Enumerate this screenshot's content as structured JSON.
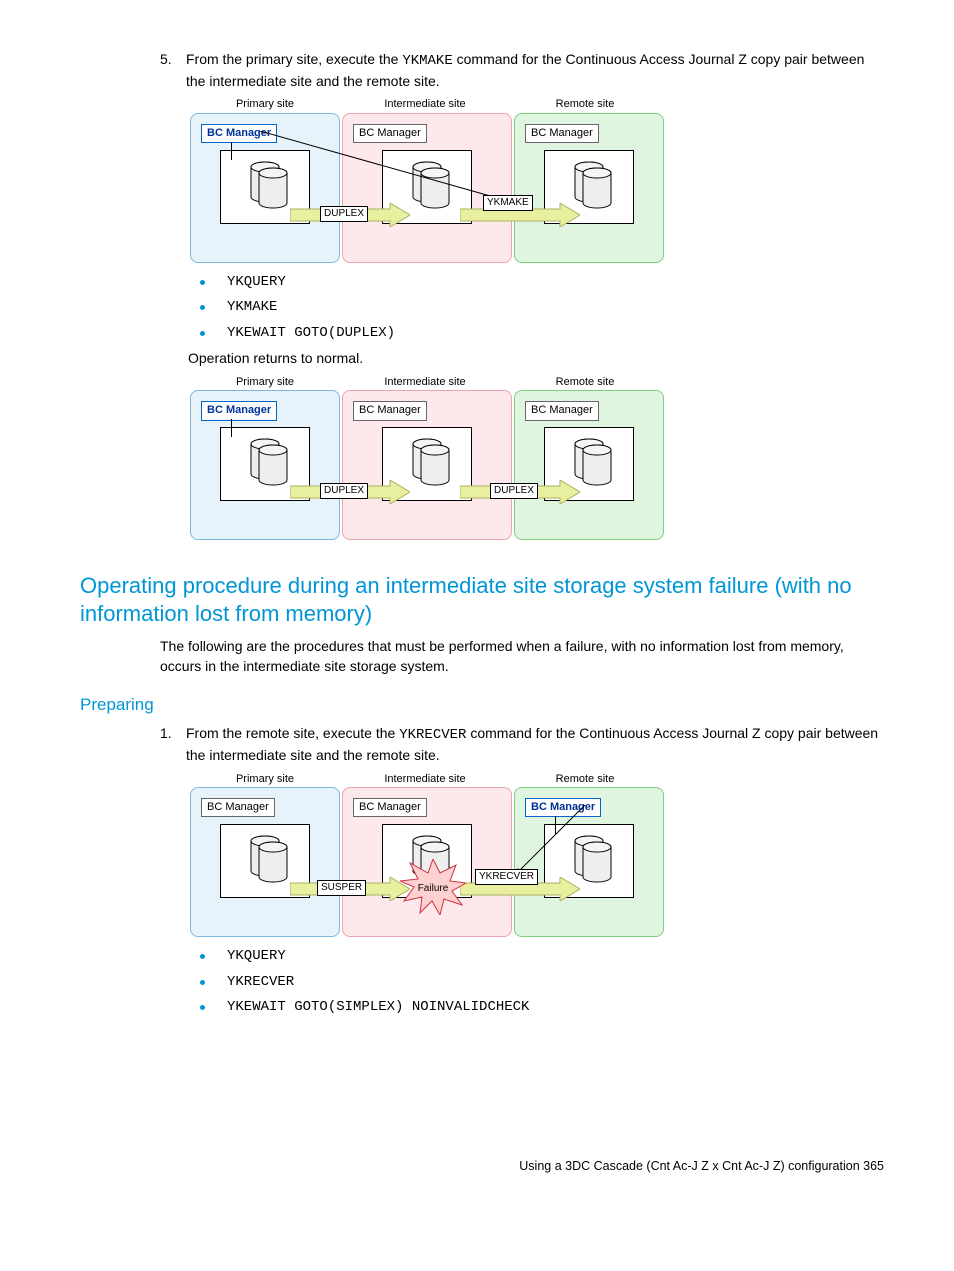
{
  "step5": {
    "num": "5.",
    "text_a": "From the primary site, execute the ",
    "cmd": "YKMAKE",
    "text_b": " command for the Continuous Access Journal Z copy pair between the intermediate site and the remote site."
  },
  "diagram_common": {
    "primary": "Primary site",
    "intermediate": "Intermediate site",
    "remote": "Remote site",
    "bc": "BC Manager"
  },
  "d1": {
    "pair_left": "DUPLEX",
    "pair_right": "YKMAKE"
  },
  "bullets1": {
    "b1": "YKQUERY",
    "b2": "YKMAKE",
    "b3": "YKEWAIT GOTO(DUPLEX)"
  },
  "return_text": "Operation returns to normal.",
  "d2": {
    "pair_left": "DUPLEX",
    "pair_right": "DUPLEX"
  },
  "heading": "Operating procedure during an intermediate site storage system failure (with no information lost from memory)",
  "heading_body": "The following are the procedures that must be performed when a failure, with no information lost from memory, occurs in the intermediate site storage system.",
  "subheading": "Preparing",
  "step1": {
    "num": "1.",
    "text_a": "From the remote site, execute the ",
    "cmd": "YKRECVER",
    "text_b": " command for the Continuous Access Journal Z copy pair between the intermediate site and the remote site."
  },
  "d3": {
    "pair_left": "SUSPER",
    "pair_right": "YKRECVER",
    "failure": "Failure"
  },
  "bullets2": {
    "b1": "YKQUERY",
    "b2": "YKRECVER",
    "b3": "YKEWAIT GOTO(SIMPLEX) NOINVALIDCHECK"
  },
  "footer": "Using a 3DC Cascade (Cnt Ac-J Z x Cnt Ac-J Z) configuration   365"
}
